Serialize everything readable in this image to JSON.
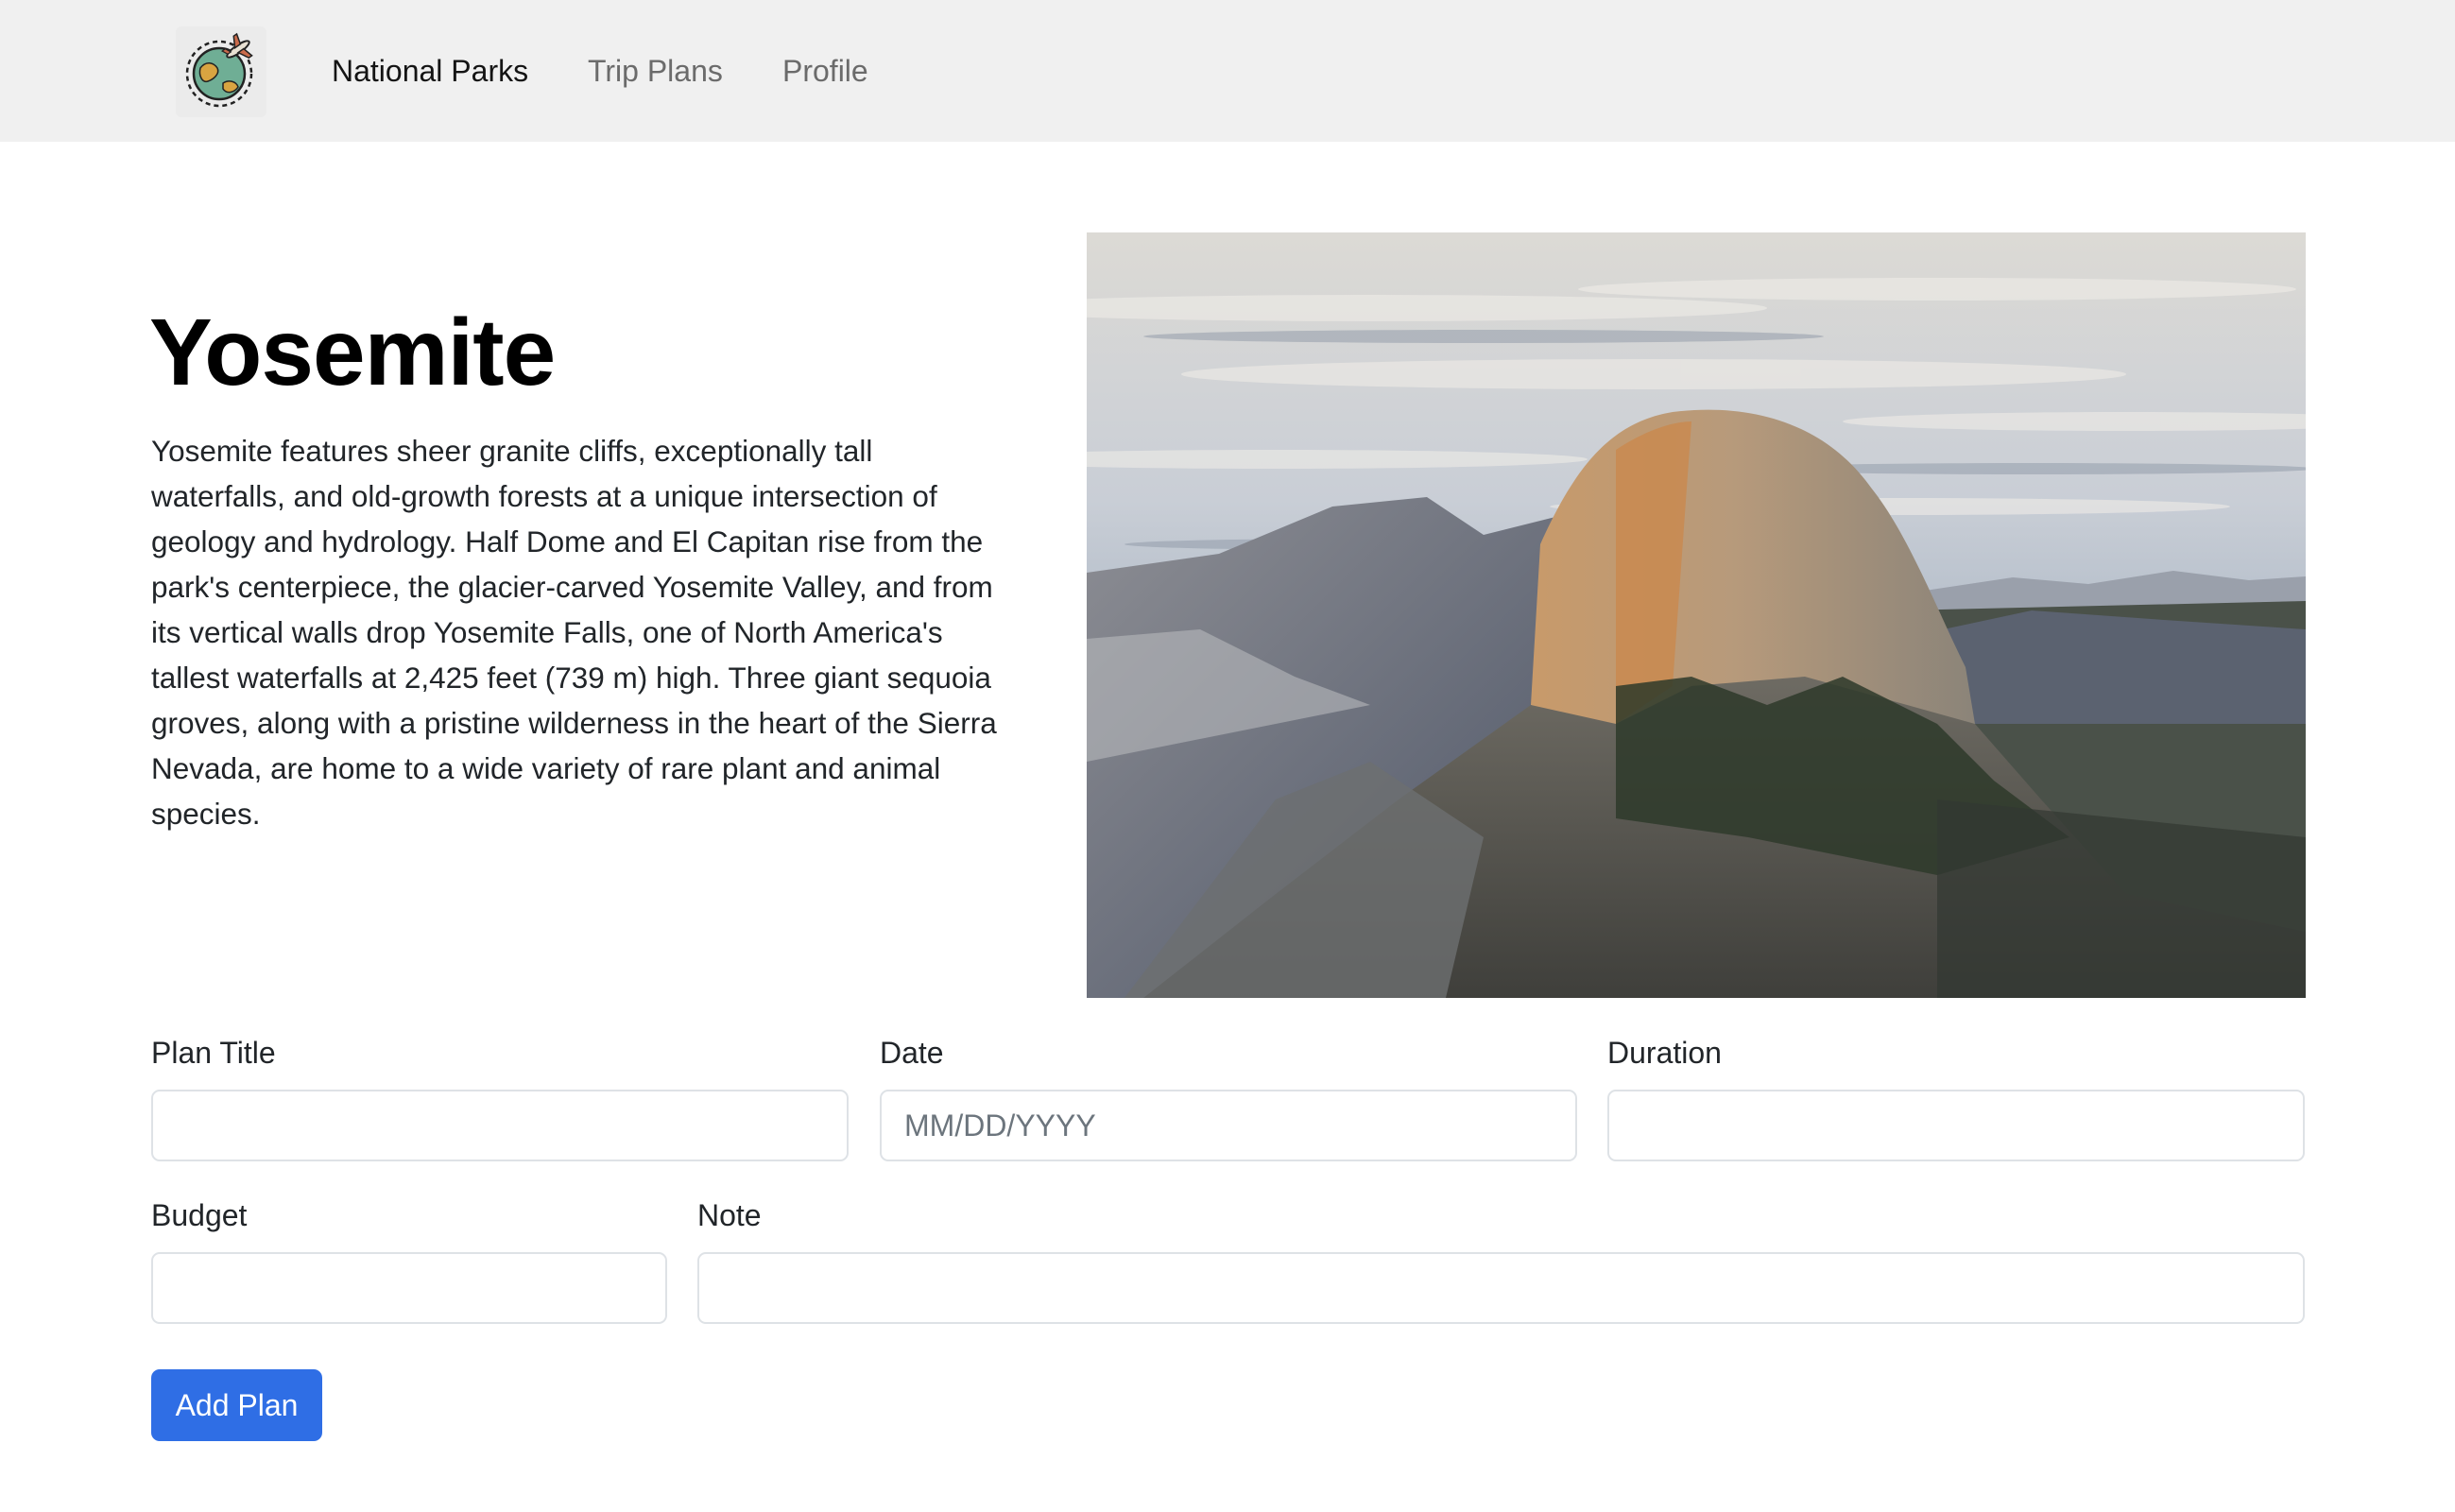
{
  "nav": {
    "logo_icon": "globe-airplane-logo-icon",
    "links": [
      {
        "label": "National Parks",
        "active": true
      },
      {
        "label": "Trip Plans",
        "active": false
      },
      {
        "label": "Profile",
        "active": false
      }
    ]
  },
  "park": {
    "name": "Yosemite",
    "description": "Yosemite features sheer granite cliffs, exceptionally tall waterfalls, and old-growth forests at a unique intersection of geology and hydrology. Half Dome and El Capitan rise from the park's centerpiece, the glacier-carved Yosemite Valley, and from its vertical walls drop Yosemite Falls, one of North America's tallest waterfalls at 2,425 feet (739 m) high. Three giant sequoia groves, along with a pristine wilderness in the heart of the Sierra Nevada, are home to a wide variety of rare plant and animal species."
  },
  "form": {
    "plan_title": {
      "label": "Plan Title",
      "value": "",
      "placeholder": ""
    },
    "date": {
      "label": "Date",
      "value": "",
      "placeholder": "MM/DD/YYYY"
    },
    "duration": {
      "label": "Duration",
      "value": "",
      "placeholder": ""
    },
    "budget": {
      "label": "Budget",
      "value": "",
      "placeholder": ""
    },
    "note": {
      "label": "Note",
      "value": "",
      "placeholder": ""
    },
    "submit_label": "Add Plan"
  },
  "colors": {
    "navbar_bg": "#f0f0f0",
    "primary_button": "#2f6ee5",
    "input_border": "#dee2e6"
  }
}
